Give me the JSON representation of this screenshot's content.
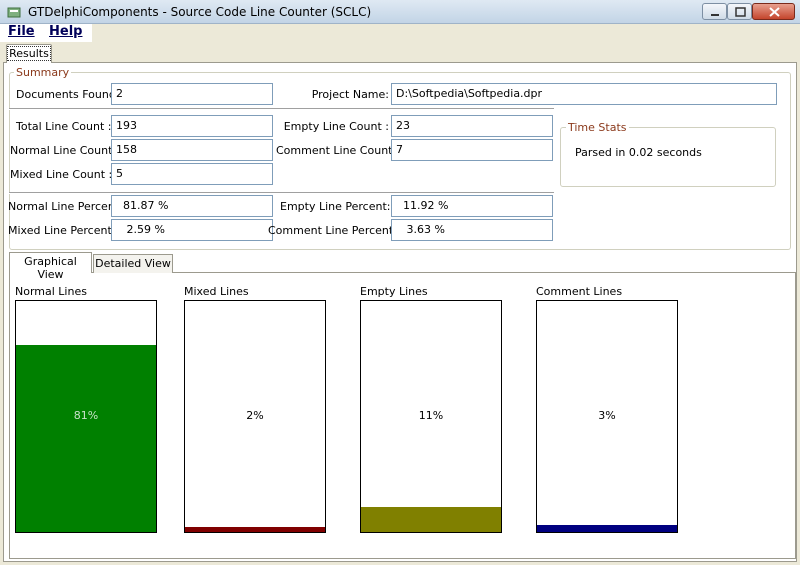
{
  "window": {
    "title": "GTDelphiComponents - Source Code Line Counter (SCLC)"
  },
  "menu": {
    "file": "File",
    "help": "Help"
  },
  "tabs": {
    "results": "Results",
    "graphical": "Graphical View",
    "detailed": "Detailed  View"
  },
  "summary": {
    "title": "Summary",
    "documents_found_label": "Documents Found :",
    "documents_found": "2",
    "project_name_label": "Project Name:",
    "project_name": "D:\\Softpedia\\Softpedia.dpr",
    "total_line_count_label": "Total Line Count :",
    "total_line_count": "193",
    "empty_line_count_label": "Empty Line Count :",
    "empty_line_count": "23",
    "normal_line_count_label": "Normal Line Count :",
    "normal_line_count": "158",
    "comment_line_count_label": "Comment Line Count :",
    "comment_line_count": "7",
    "mixed_line_count_label": "Mixed Line Count :",
    "mixed_line_count": "5",
    "normal_line_percent_label": "Normal Line Percent:",
    "normal_line_percent": "  81.87 %",
    "empty_line_percent_label": "Empty Line Percent:",
    "empty_line_percent": "  11.92 %",
    "mixed_line_percent_label": "Mixed Line Percent :",
    "mixed_line_percent": "   2.59 %",
    "comment_line_percent_label": "Comment Line Percent :",
    "comment_line_percent": "   3.63 %"
  },
  "time_stats": {
    "title": "Time Stats",
    "text": "Parsed in 0.02 seconds"
  },
  "bars": [
    {
      "title": "Normal Lines",
      "label": "81%",
      "fraction": 0.81,
      "color": "#008000",
      "label_color": "#c8e0c8"
    },
    {
      "title": "Mixed Lines",
      "label": "2%",
      "fraction": 0.02,
      "color": "#800000",
      "label_color": "#000000"
    },
    {
      "title": "Empty Lines",
      "label": "11%",
      "fraction": 0.11,
      "color": "#808000",
      "label_color": "#000000"
    },
    {
      "title": "Comment Lines",
      "label": "3%",
      "fraction": 0.03,
      "color": "#000080",
      "label_color": "#000000"
    }
  ],
  "icons": {
    "app": "app-icon",
    "minimize": "minimize-icon",
    "maximize": "maximize-icon",
    "close": "close-icon"
  }
}
